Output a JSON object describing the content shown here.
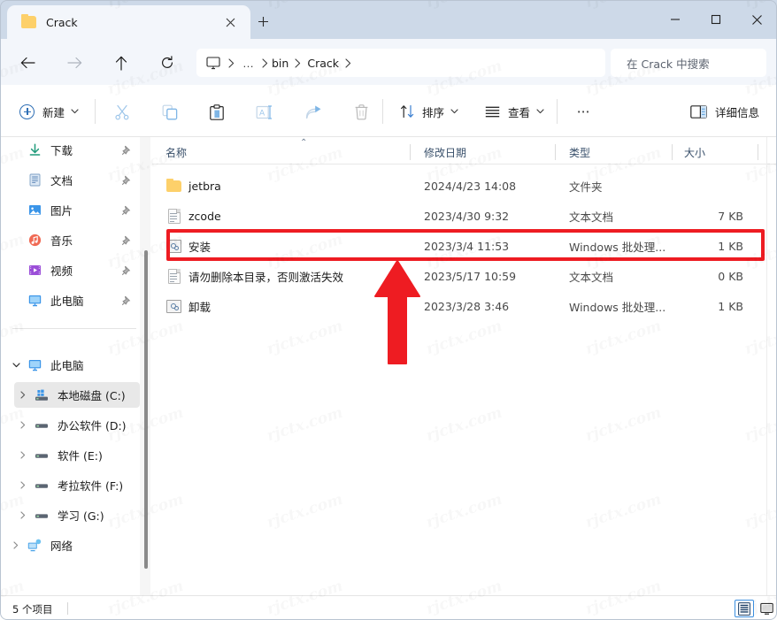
{
  "window": {
    "tab_title": "Crack",
    "tab_folder_icon": "folder-icon",
    "close_tab_label": "×",
    "new_tab_label": "+",
    "minimize_label": "minimize-icon",
    "maximize_label": "maximize-icon",
    "close_label": "close-icon"
  },
  "navigation": {
    "back": "back-arrow-icon",
    "forward": "forward-arrow-icon",
    "up": "up-arrow-icon",
    "refresh": "refresh-icon",
    "breadcrumb": {
      "root_icon": "this-pc-icon",
      "ellipsis": "…",
      "items": [
        "bin",
        "Crack"
      ]
    },
    "search_placeholder": "在 Crack 中搜索"
  },
  "toolbar": {
    "new_label": "新建",
    "cut_icon": "scissors-icon",
    "copy_icon": "copy-icon",
    "paste_icon": "paste-icon",
    "rename_icon": "rename-icon",
    "share_icon": "share-icon",
    "delete_icon": "trash-icon",
    "sort_label": "排序",
    "sort_icon": "sort-icon",
    "view_label": "查看",
    "view_icon": "view-list-icon",
    "more_label": "⋯",
    "details_label": "详细信息",
    "details_icon": "details-pane-icon"
  },
  "sidebar": {
    "quick_access": [
      {
        "label": "下载",
        "icon": "download-icon",
        "pinned": true,
        "selected": false
      },
      {
        "label": "文档",
        "icon": "documents-icon",
        "pinned": true,
        "selected": false
      },
      {
        "label": "图片",
        "icon": "pictures-icon",
        "pinned": true,
        "selected": false
      },
      {
        "label": "音乐",
        "icon": "music-icon",
        "pinned": true,
        "selected": false
      },
      {
        "label": "视频",
        "icon": "videos-icon",
        "pinned": true,
        "selected": false
      },
      {
        "label": "此电脑",
        "icon": "this-pc-icon",
        "pinned": true,
        "selected": false
      }
    ],
    "tree": [
      {
        "label": "此电脑",
        "icon": "this-pc-icon",
        "expanded": true,
        "indent": 0,
        "selected": false
      },
      {
        "label": "本地磁盘 (C:)",
        "icon": "windows-drive-icon",
        "expanded": false,
        "indent": 1,
        "selected": true
      },
      {
        "label": "办公软件 (D:)",
        "icon": "drive-icon",
        "expanded": false,
        "indent": 1,
        "selected": false
      },
      {
        "label": "软件 (E:)",
        "icon": "drive-icon",
        "expanded": false,
        "indent": 1,
        "selected": false
      },
      {
        "label": "考拉软件 (F:)",
        "icon": "drive-icon",
        "expanded": false,
        "indent": 1,
        "selected": false
      },
      {
        "label": "学习 (G:)",
        "icon": "drive-icon",
        "expanded": false,
        "indent": 1,
        "selected": false
      },
      {
        "label": "网络",
        "icon": "network-icon",
        "expanded": false,
        "indent": 0,
        "selected": false
      }
    ]
  },
  "filelist": {
    "columns": [
      {
        "label": "名称",
        "sorted": true
      },
      {
        "label": "修改日期",
        "sorted": false
      },
      {
        "label": "类型",
        "sorted": false
      },
      {
        "label": "大小",
        "sorted": false
      }
    ],
    "rows": [
      {
        "name": "jetbra",
        "date": "2024/4/23 14:08",
        "type": "文件夹",
        "size": "",
        "icon": "folder-icon",
        "highlighted": false
      },
      {
        "name": "zcode",
        "date": "2023/4/30 9:32",
        "type": "文本文档",
        "size": "7 KB",
        "icon": "text-file-icon",
        "highlighted": false
      },
      {
        "name": "安装",
        "date": "2023/3/4 11:53",
        "type": "Windows 批处理...",
        "size": "1 KB",
        "icon": "batch-file-icon",
        "highlighted": true
      },
      {
        "name": "请勿删除本目录，否则激活失效",
        "date": "2023/5/17 10:59",
        "type": "文本文档",
        "size": "0 KB",
        "icon": "text-file-icon",
        "highlighted": false
      },
      {
        "name": "卸载",
        "date": "2023/3/28 3:46",
        "type": "Windows 批处理...",
        "size": "1 KB",
        "icon": "batch-file-icon",
        "highlighted": false
      }
    ]
  },
  "statusbar": {
    "item_count": "5 个项目",
    "details_view_icon": "details-view-icon",
    "large_icons_view_icon": "large-icons-view-icon"
  },
  "annotations": {
    "highlight_color": "#ee1c22",
    "arrow_color": "#ee1c22",
    "watermark_text": "rjctx.com"
  },
  "colors": {
    "titlebar": "#cdd9e8",
    "chrome": "#f3f6fb",
    "content": "#ffffff",
    "accent": "#2f6fb5",
    "header_text": "#39506b"
  }
}
